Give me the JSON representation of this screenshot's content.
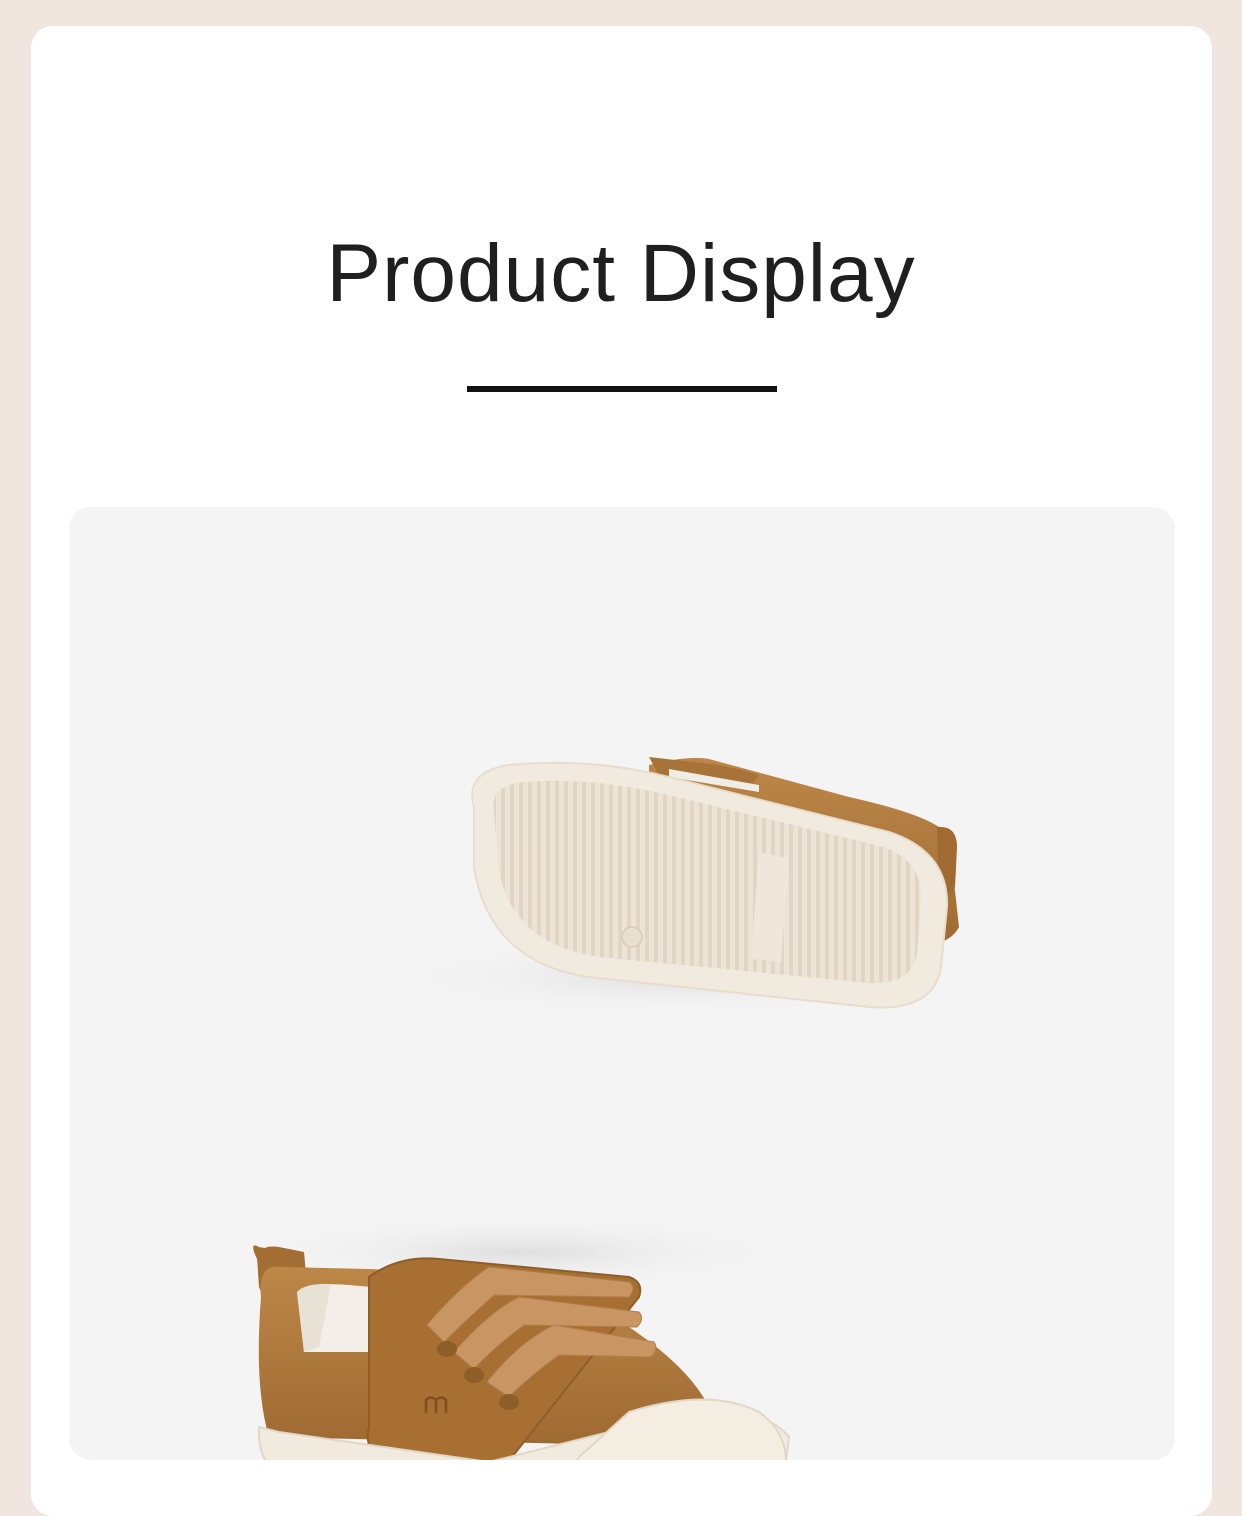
{
  "section": {
    "title": "Product Display"
  },
  "product_photo": {
    "subject": "toddler-canvas-sneaker",
    "colors": {
      "upper": "#b07a3c",
      "strap": "#c79361",
      "sole": "#f1ebdf",
      "background": "#f4f4f4"
    }
  }
}
